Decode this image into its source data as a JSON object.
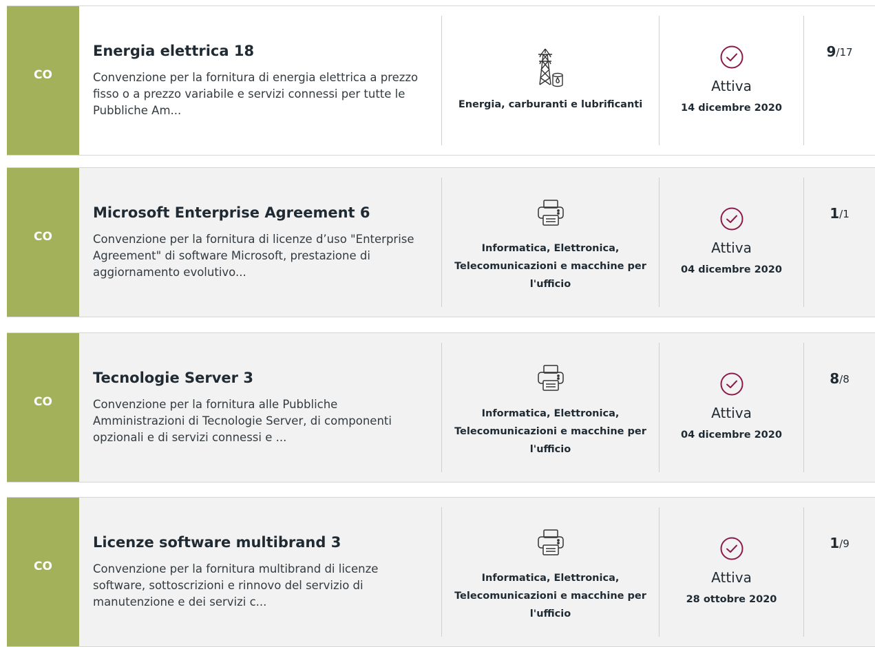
{
  "items": [
    {
      "badge": "CO",
      "title": "Energia elettrica 18",
      "description": "Convenzione per la fornitura di energia elettrica a prezzo fisso o a prezzo variabile e servizi connessi per tutte le Pubbliche Am...",
      "category_icon": "power-tower-icon",
      "category": "Energia, carburanti e lubrificanti",
      "status_icon": "check-circle-icon",
      "status": "Attiva",
      "date": "14 dicembre 2020",
      "count_active": "9",
      "count_total": "/17"
    },
    {
      "badge": "CO",
      "title": "Microsoft Enterprise Agreement 6",
      "description": "Convenzione per la fornitura di licenze d’uso \"Enterprise Agreement\" di software Microsoft, prestazione di aggiornamento evolutivo...",
      "category_icon": "printer-icon",
      "category": "Informatica, Elettronica, Telecomunicazioni e macchine per l'ufficio",
      "status_icon": "check-circle-icon",
      "status": "Attiva",
      "date": "04 dicembre 2020",
      "count_active": "1",
      "count_total": "/1"
    },
    {
      "badge": "CO",
      "title": "Tecnologie Server 3",
      "description": "Convenzione per la fornitura alle Pubbliche Amministrazioni di Tecnologie Server, di componenti opzionali e di servizi connessi e ...",
      "category_icon": "printer-icon",
      "category": "Informatica, Elettronica, Telecomunicazioni e macchine per l'ufficio",
      "status_icon": "check-circle-icon",
      "status": "Attiva",
      "date": "04 dicembre 2020",
      "count_active": "8",
      "count_total": "/8"
    },
    {
      "badge": "CO",
      "title": "Licenze software multibrand 3",
      "description": "Convenzione per la fornitura multibrand di licenze software, sottoscrizioni e rinnovo del servizio di manutenzione e dei servizi c...",
      "category_icon": "printer-icon",
      "category": "Informatica, Elettronica, Telecomunicazioni e macchine per l'ufficio",
      "status_icon": "check-circle-icon",
      "status": "Attiva",
      "date": "28 ottobre 2020",
      "count_active": "1",
      "count_total": "/9"
    }
  ],
  "colors": {
    "badge_bg": "#a3b25a",
    "status_accent": "#8b1a4a",
    "card_alt_bg": "#f2f2f2"
  }
}
